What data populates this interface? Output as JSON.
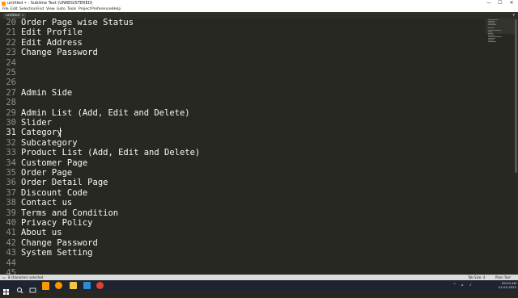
{
  "window": {
    "title": "untitled • - Sublime Text (UNREGISTERED)",
    "controls": {
      "minimize": "—",
      "maximize": "☐",
      "close": "✕"
    }
  },
  "menu": [
    "File",
    "Edit",
    "Selection",
    "Find",
    "View",
    "Goto",
    "Tools",
    "Project",
    "Preferences",
    "Help"
  ],
  "tab": {
    "label": "untitled",
    "close": "×"
  },
  "editor": {
    "current_line": 31,
    "lines": [
      {
        "num": "20",
        "text": "Order Page wise Status"
      },
      {
        "num": "21",
        "text": "Edit Profile"
      },
      {
        "num": "22",
        "text": "Edit Address"
      },
      {
        "num": "23",
        "text": "Change Password"
      },
      {
        "num": "24",
        "text": ""
      },
      {
        "num": "25",
        "text": ""
      },
      {
        "num": "26",
        "text": ""
      },
      {
        "num": "27",
        "text": "Admin Side"
      },
      {
        "num": "28",
        "text": ""
      },
      {
        "num": "29",
        "text": "Admin List (Add, Edit and Delete)"
      },
      {
        "num": "30",
        "text": "Slider"
      },
      {
        "num": "31",
        "text": "Category"
      },
      {
        "num": "32",
        "text": "Subcategory"
      },
      {
        "num": "33",
        "text": "Product List (Add, Edit and Delete)"
      },
      {
        "num": "34",
        "text": "Customer Page"
      },
      {
        "num": "35",
        "text": "Order Page"
      },
      {
        "num": "36",
        "text": "Order Detail Page"
      },
      {
        "num": "37",
        "text": "Discount Code"
      },
      {
        "num": "38",
        "text": "Contact us"
      },
      {
        "num": "39",
        "text": "Terms and Condition"
      },
      {
        "num": "40",
        "text": "Privacy Policy"
      },
      {
        "num": "41",
        "text": "About us"
      },
      {
        "num": "42",
        "text": "Change Password"
      },
      {
        "num": "43",
        "text": "System Setting"
      },
      {
        "num": "44",
        "text": ""
      },
      {
        "num": "45",
        "text": ""
      }
    ]
  },
  "status": {
    "left": "8 characters selected",
    "tab_size": "Tab Size: 4",
    "syntax": "Plain Text"
  },
  "taskbar": {
    "time": "09:03 AM",
    "date": "22-04-2022",
    "colors": {
      "start": "#ffffff",
      "search": "#ffffff",
      "chrome": "#e34133",
      "firefox": "#ff9500",
      "sublime": "#ff9800",
      "files": "#f4c542",
      "photos": "#2a8dd4"
    }
  }
}
